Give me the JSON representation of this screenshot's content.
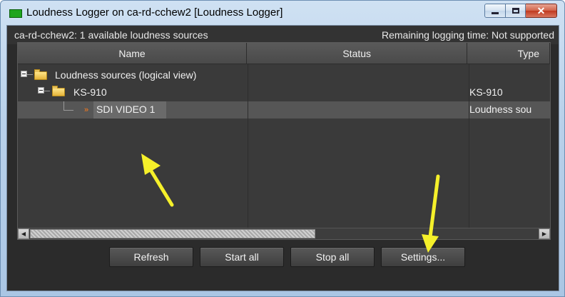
{
  "window": {
    "title": "Loudness Logger on ca-rd-cchew2 [Loudness Logger]",
    "close_glyph": "✕"
  },
  "status": {
    "sources_text": "ca-rd-cchew2: 1 available loudness sources",
    "remaining_text": "Remaining logging time: Not supported"
  },
  "table": {
    "columns": [
      "Name",
      "Status",
      "Type"
    ],
    "rows": [
      {
        "name": "Loudness sources (logical view)",
        "status": "",
        "type": ""
      },
      {
        "name": "KS-910",
        "status": "",
        "type": "KS-910"
      },
      {
        "name": "SDI VIDEO 1",
        "status": "",
        "type": "Loudness sou"
      }
    ],
    "selected_row": 2
  },
  "buttons": {
    "refresh": "Refresh",
    "start_all": "Start all",
    "stop_all": "Stop all",
    "settings": "Settings..."
  },
  "colors": {
    "annotation_arrow": "#f5f02a",
    "app_icon": "#1fa51f",
    "rss_icon": "#ff7b1a"
  },
  "icons": [
    "app-icon",
    "minimize-icon",
    "maximize-icon",
    "close-icon",
    "collapse-icon",
    "folder-icon",
    "source-icon",
    "scroll-left-icon",
    "scroll-right-icon"
  ]
}
